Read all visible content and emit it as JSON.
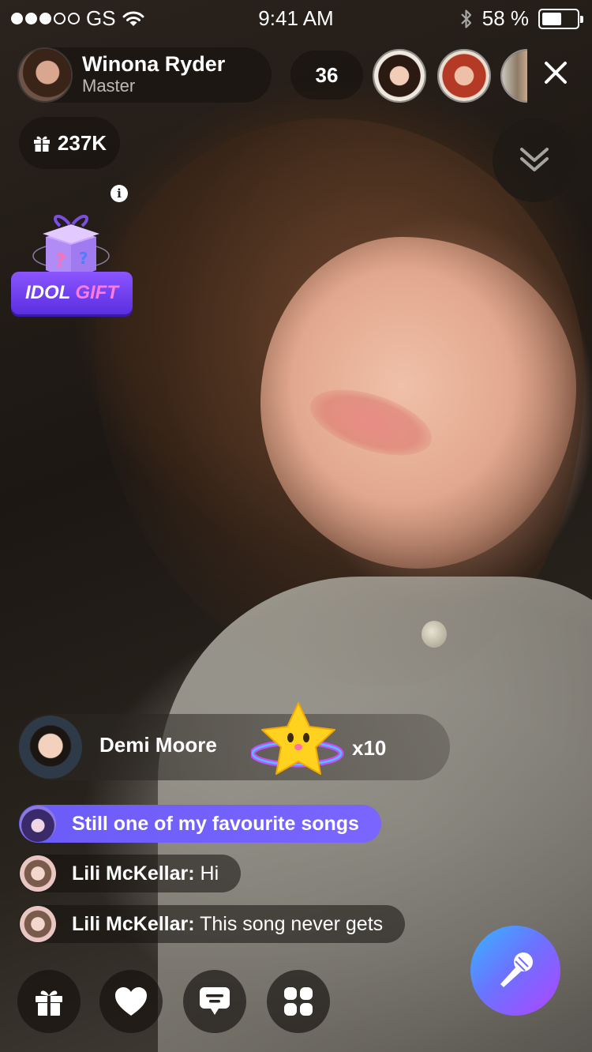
{
  "status_bar": {
    "carrier": "GS",
    "time": "9:41 AM",
    "battery_percent": "58 %",
    "battery_level": 0.58
  },
  "host": {
    "name": "Winona Ryder",
    "role": "Master"
  },
  "viewers": {
    "count": "36"
  },
  "gifts_total": "237K",
  "idol_gift": {
    "label_part1": "IDOL",
    "label_part2": "GIFT",
    "info_glyph": "i"
  },
  "gift_banner": {
    "sender": "Demi Moore",
    "multiplier": "x10"
  },
  "chat": [
    {
      "user": "",
      "text": "Still one of my favourite songs"
    },
    {
      "user": "Lili McKellar:",
      "text": "Hi"
    },
    {
      "user": "Lili McKellar:",
      "text": "This song never gets"
    }
  ],
  "icons": {
    "gift": "gift-icon",
    "like": "heart-icon",
    "comment": "chat-bubble-icon",
    "more": "apps-grid-icon",
    "mic": "microphone-icon",
    "close": "close-icon",
    "collapse": "chevron-double-down-icon"
  },
  "colors": {
    "chat_highlight": "#6b5cf7",
    "idol_gift_purple": "#7a45f5",
    "mic_gradient_start": "#35b6ff",
    "mic_gradient_end": "#b044ff"
  }
}
